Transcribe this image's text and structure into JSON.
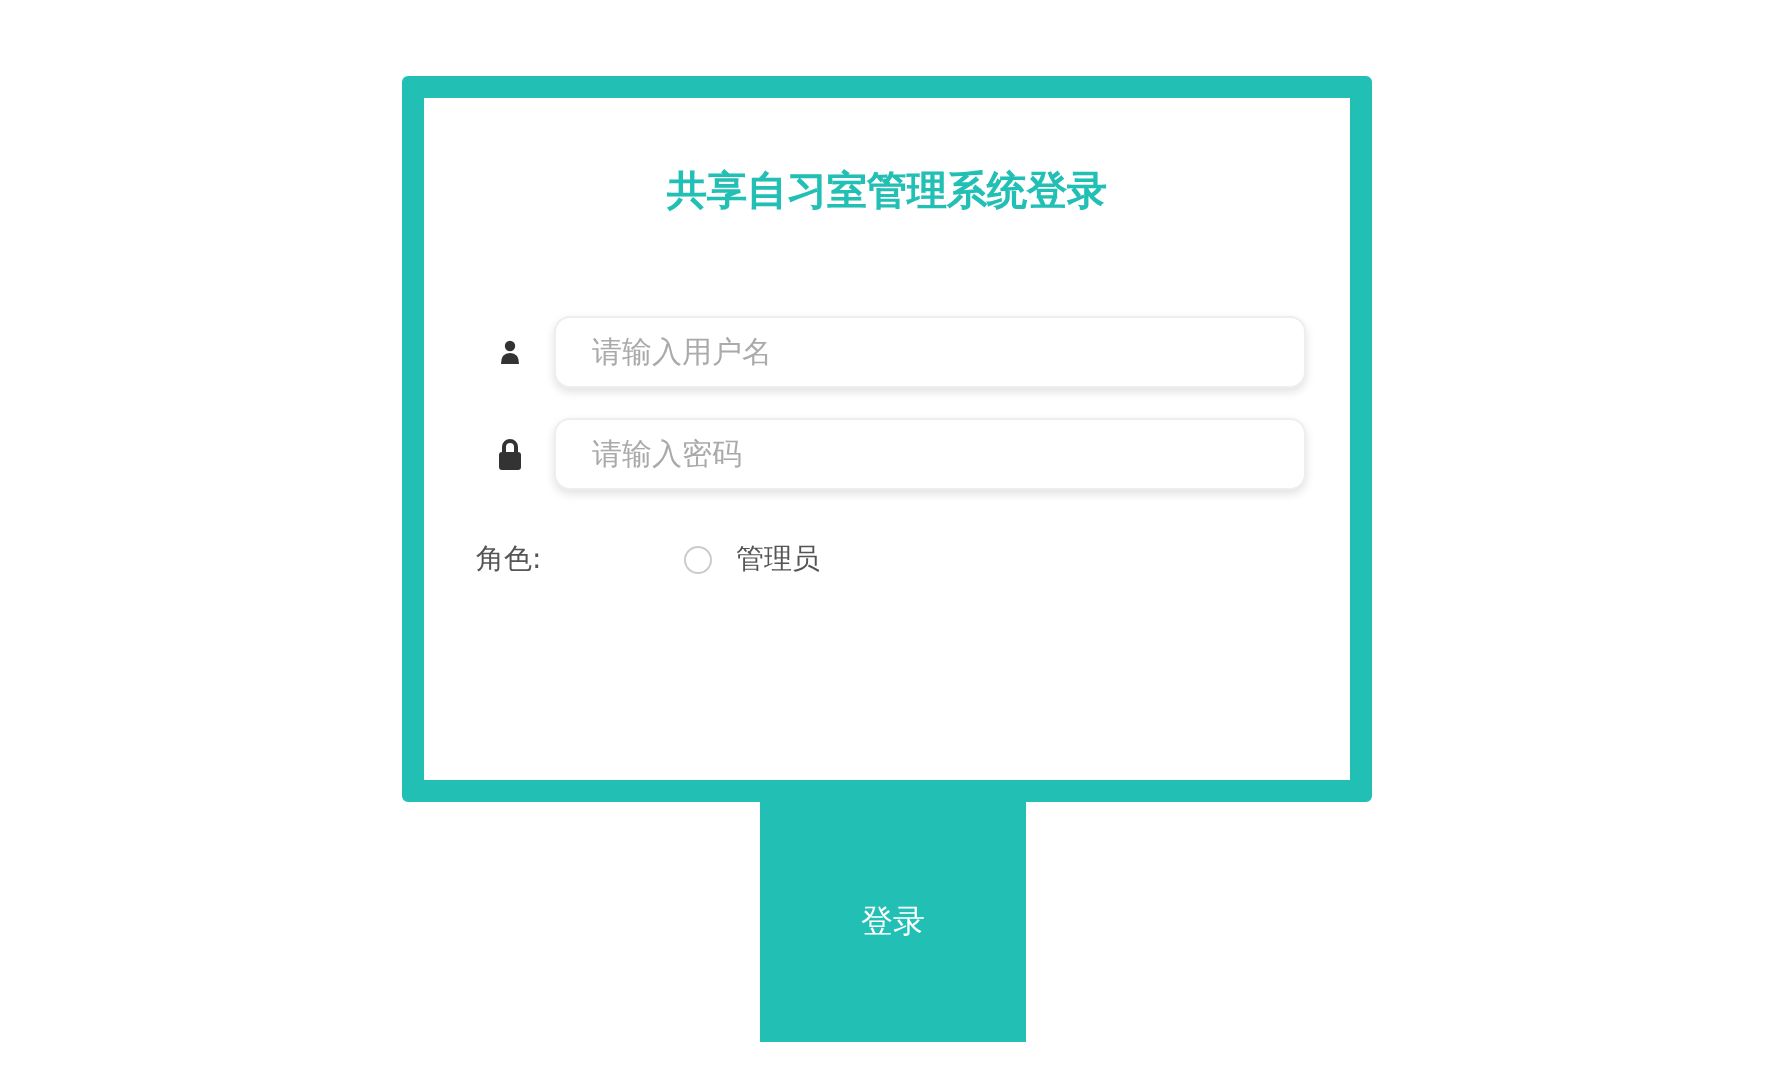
{
  "title": "共享自习室管理系统登录",
  "fields": [
    {
      "kind": "user",
      "placeholder": "请输入用户名"
    },
    {
      "kind": "lock",
      "placeholder": "请输入密码"
    }
  ],
  "role": {
    "label": "角色:",
    "options": [
      {
        "label": "管理员",
        "selected": false
      }
    ]
  },
  "button": "登录"
}
